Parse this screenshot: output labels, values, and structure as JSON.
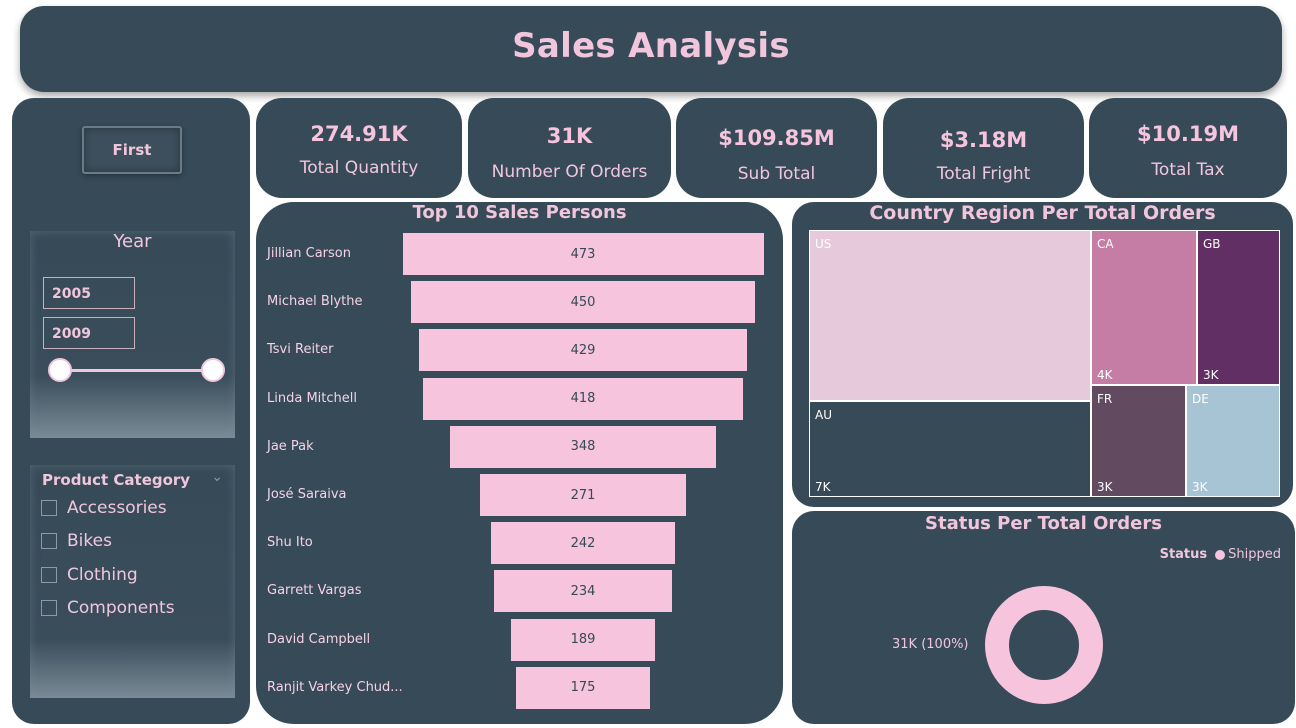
{
  "header": {
    "title": "Sales Analysis"
  },
  "sidebar": {
    "first_button": "First",
    "year_slicer": {
      "title": "Year",
      "start": "2005",
      "end": "2009"
    },
    "category_slicer": {
      "title": "Product Category",
      "items": [
        {
          "label": "Accessories",
          "checked": false
        },
        {
          "label": "Bikes",
          "checked": false
        },
        {
          "label": "Clothing",
          "checked": false
        },
        {
          "label": "Components",
          "checked": false
        }
      ]
    }
  },
  "kpis": {
    "quantity": {
      "value": "274.91K",
      "label": "Total Quantity"
    },
    "orders": {
      "value": "31K",
      "label": "Number Of Orders"
    },
    "subtotal": {
      "value": "$109.85M",
      "label": "Sub Total"
    },
    "fright": {
      "value": "$3.18M",
      "label": "Total Fright"
    },
    "tax": {
      "value": "$10.19M",
      "label": "Total Tax"
    }
  },
  "colors": {
    "panel": "#364a58",
    "accent_pink": "#f6c4dd",
    "treemap": [
      "#e6cadb",
      "#364a58",
      "#c57ca5",
      "#612f63",
      "#624a60",
      "#a7c4d4"
    ]
  },
  "chart_data": [
    {
      "type": "bar",
      "subtype": "funnel",
      "title": "Top 10 Sales Persons",
      "categories": [
        "Jillian Carson",
        "Michael Blythe",
        "Tsvi Reiter",
        "Linda Mitchell",
        "Jae Pak",
        "José Saraiva",
        "Shu Ito",
        "Garrett Vargas",
        "David Campbell",
        "Ranjit Varkey Chud..."
      ],
      "values": [
        473,
        450,
        429,
        418,
        348,
        271,
        242,
        234,
        189,
        175
      ]
    },
    {
      "type": "treemap",
      "title": "Country Region Per Total Orders",
      "items": [
        {
          "label": "US",
          "value": 12,
          "value_label": ""
        },
        {
          "label": "AU",
          "value": 7,
          "value_label": "7K"
        },
        {
          "label": "CA",
          "value": 4,
          "value_label": "4K"
        },
        {
          "label": "GB",
          "value": 3,
          "value_label": "3K"
        },
        {
          "label": "FR",
          "value": 3,
          "value_label": "3K"
        },
        {
          "label": "DE",
          "value": 3,
          "value_label": "3K"
        }
      ]
    },
    {
      "type": "pie",
      "subtype": "donut",
      "title": "Status Per Total Orders",
      "legend_title": "Status",
      "legend_position": "top-right",
      "slices": [
        {
          "name": "Shipped",
          "value": 31000,
          "percent": 100
        }
      ],
      "data_label": "31K (100%)"
    }
  ]
}
